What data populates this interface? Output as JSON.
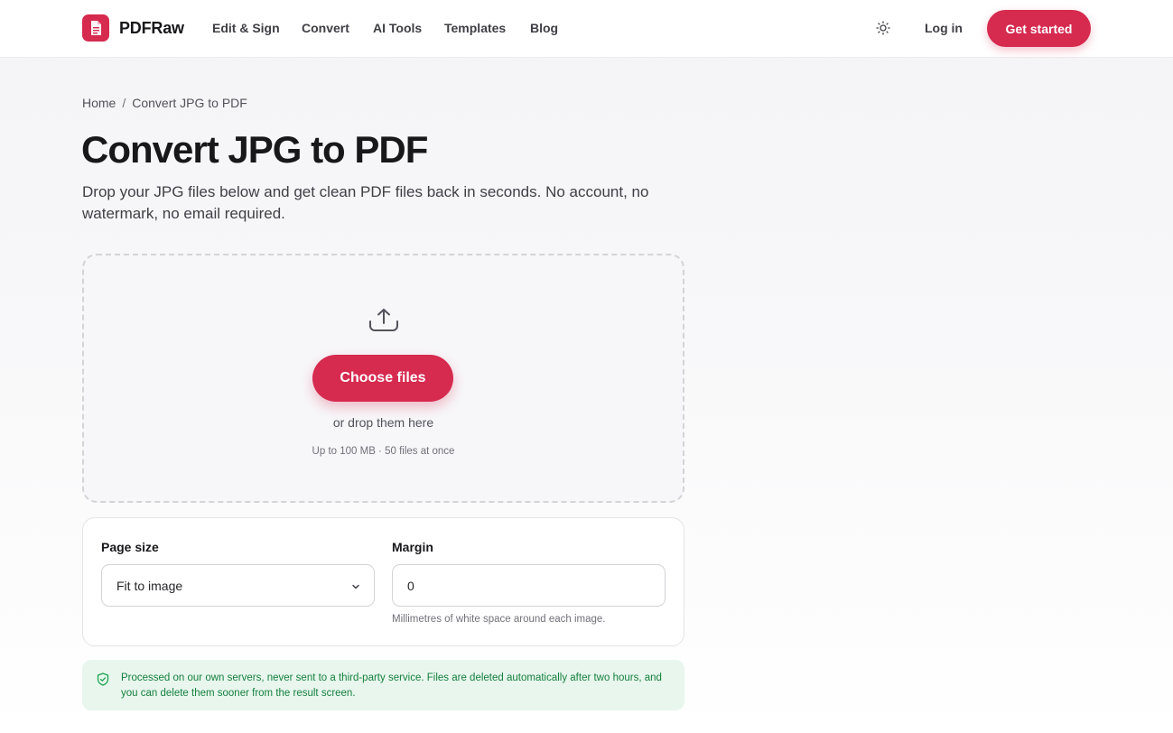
{
  "brand": {
    "name": "PDFRaw",
    "accent": "#d62a4f"
  },
  "nav": {
    "items": [
      {
        "label": "Edit & Sign"
      },
      {
        "label": "Convert"
      },
      {
        "label": "AI Tools"
      },
      {
        "label": "Templates"
      },
      {
        "label": "Blog"
      }
    ],
    "theme_icon": "sun-icon",
    "login_label": "Log in",
    "cta_label": "Get started"
  },
  "breadcrumb": {
    "home": "Home",
    "separator": "/",
    "current": "Convert JPG to PDF"
  },
  "page": {
    "title": "Convert JPG to PDF",
    "subtitle": "Drop your JPG files below and get clean PDF files back in seconds. No account, no watermark, no email required."
  },
  "dropzone": {
    "icon": "upload-icon",
    "button_label": "Choose files",
    "hint": "or drop them here",
    "limits": "Up to 100 MB · 50 files at once"
  },
  "options": {
    "page_size": {
      "label": "Page size",
      "value": "Fit to image"
    },
    "margin": {
      "label": "Margin",
      "value": "0",
      "help": "Millimetres of white space around each image."
    }
  },
  "privacy": {
    "icon": "shield-check-icon",
    "text": "Processed on our own servers, never sent to a third-party service. Files are deleted automatically after two hours, and you can delete them sooner from the result screen.",
    "color": "#15803d"
  }
}
